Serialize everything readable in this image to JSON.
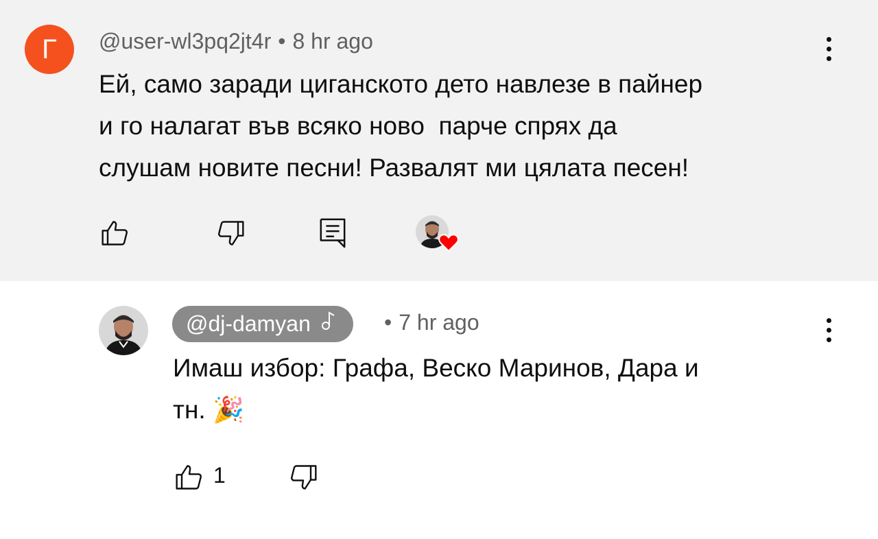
{
  "comment": {
    "avatar_letter": "Г",
    "avatar_color": "#f4511e",
    "author": "@user-wl3pq2jt4r",
    "separator": "•",
    "time": "8 hr ago",
    "text": "Ей, само заради циганското дето навлезе в пайнер\nи го налагат във всяко ново  парче спрях да\nслушам новите песни! Развалят ми цялата песен!",
    "actions": {
      "like_icon": "thumb-up-icon",
      "dislike_icon": "thumb-down-icon",
      "reply_icon": "reply-comment-icon",
      "creator_heart": "creator-heart-icon"
    }
  },
  "reply": {
    "author": "@dj-damyan",
    "author_badge_icon": "music-note-icon",
    "separator": "•",
    "time": "7 hr ago",
    "text": "Имаш избор: Графа, Веско Маринов, Дара и\nтн. 🎉",
    "like_count": "1"
  },
  "colors": {
    "top_background": "#f2f2f2",
    "chip_background": "#8a8a8a",
    "heart": "#ff0000",
    "meta_text": "#606060"
  }
}
